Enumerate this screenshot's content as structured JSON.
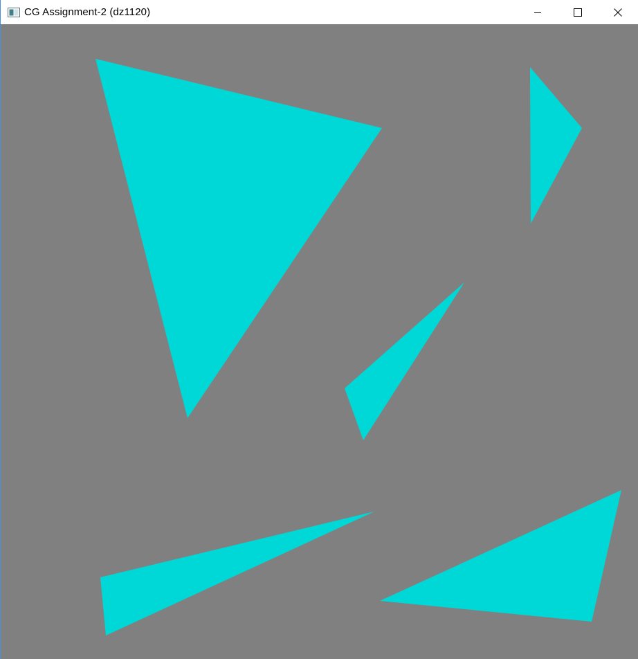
{
  "window": {
    "title": "CG Assignment-2 (dz1120)",
    "app_icon": "window-app-icon",
    "controls": [
      {
        "name": "minimize-button",
        "icon": "minimize-icon"
      },
      {
        "name": "maximize-button",
        "icon": "maximize-icon"
      },
      {
        "name": "close-button",
        "icon": "close-icon"
      }
    ]
  },
  "canvas": {
    "background_color": "#808080",
    "fill_color": "#00D8D8",
    "shape_count": 5
  }
}
